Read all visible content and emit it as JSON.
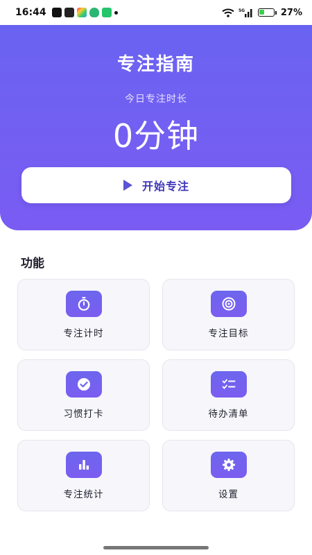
{
  "status_bar": {
    "time": "16:44",
    "battery": "27%",
    "network": "5G"
  },
  "hero": {
    "title": "专注指南",
    "today_label": "今日专注时长",
    "today_value": "0分钟",
    "start_button": "开始专注"
  },
  "section_title": "功能",
  "features": [
    {
      "label": "专注计时",
      "icon": "stopwatch-icon"
    },
    {
      "label": "专注目标",
      "icon": "target-icon"
    },
    {
      "label": "习惯打卡",
      "icon": "check-circle-icon"
    },
    {
      "label": "待办清单",
      "icon": "checklist-icon"
    },
    {
      "label": "专注统计",
      "icon": "bar-chart-icon"
    },
    {
      "label": "设置",
      "icon": "gear-icon"
    }
  ],
  "colors": {
    "accent": "#6a63f1",
    "accent_dark": "#3f37b8",
    "card_bg": "#f7f7fb"
  }
}
